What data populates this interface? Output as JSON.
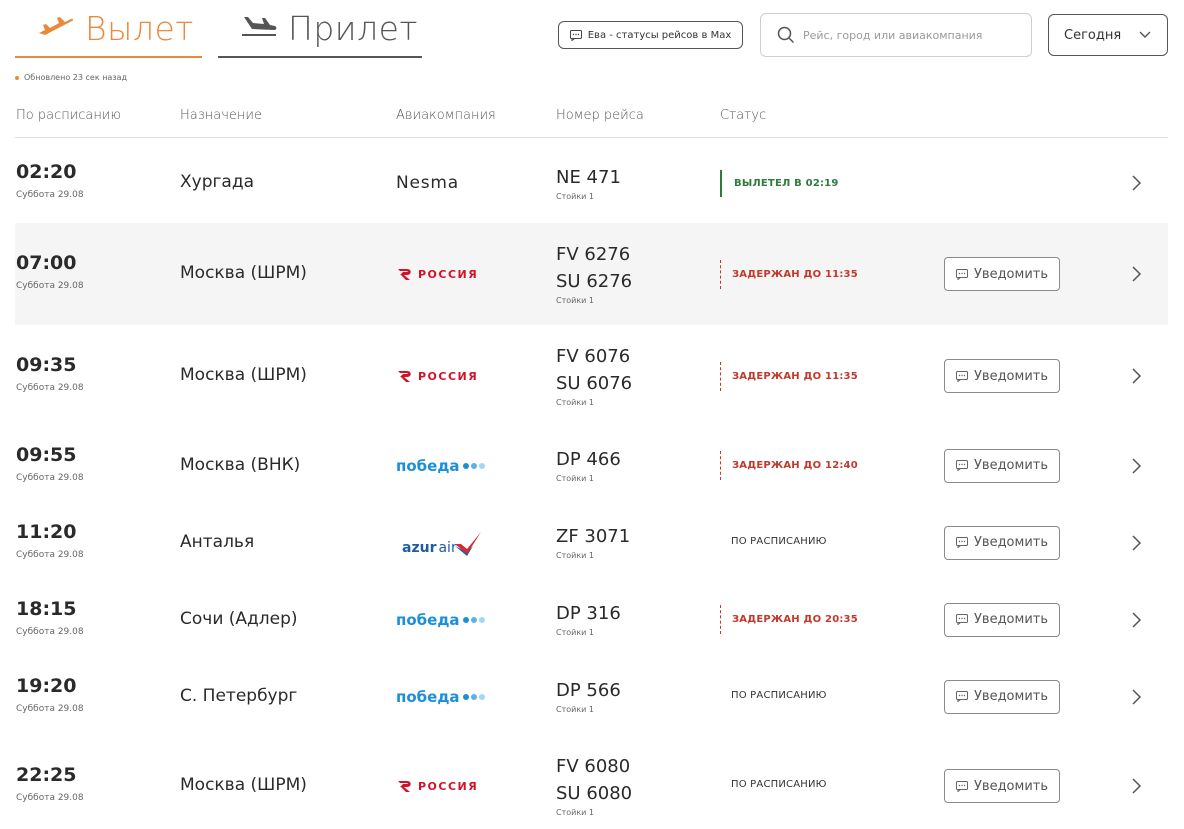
{
  "header": {
    "tab_departure": "Вылет",
    "tab_arrival": "Прилет",
    "updated": "Обновлено 23 сек назад",
    "eva_button": "Ева - статусы рейсов в Max",
    "search_placeholder": "Рейс, город или авиакомпания",
    "date_select": "Сегодня"
  },
  "columns": {
    "scheduled": "По расписанию",
    "destination": "Назначение",
    "airline": "Авиакомпания",
    "flight": "Номер рейса",
    "status": "Статус"
  },
  "notify_label": "Уведомить",
  "airline_labels": {
    "rossiya": "РОССИЯ",
    "pobeda": "победа",
    "azur_1": "azur",
    "azur_2": "air"
  },
  "colors": {
    "accent": "#e88a3c",
    "departed": "#2f7a3d",
    "delayed": "#c0392b",
    "rossiya_red": "#d1132a",
    "pobeda_blue": "#1c8fd9",
    "azur_blue": "#1f5ca8"
  },
  "flights": [
    {
      "time": "02:20",
      "date": "Суббота 29.08",
      "destination": "Хургада",
      "airline": "Nesma",
      "flights": [
        "NE 471"
      ],
      "gates": "Стойки 1",
      "status": "ВЫЛЕТЕЛ В 02:19",
      "status_type": "departed",
      "notify": false
    },
    {
      "time": "07:00",
      "date": "Суббота 29.08",
      "destination": "Москва (ШРМ)",
      "airline": "rossiya",
      "flights": [
        "FV 6276",
        "SU 6276"
      ],
      "gates": "Стойки 1",
      "status": "ЗАДЕРЖАН ДО 11:35",
      "status_type": "delayed",
      "notify": true
    },
    {
      "time": "09:35",
      "date": "Суббота 29.08",
      "destination": "Москва (ШРМ)",
      "airline": "rossiya",
      "flights": [
        "FV 6076",
        "SU 6076"
      ],
      "gates": "Стойки 1",
      "status": "ЗАДЕРЖАН ДО 11:35",
      "status_type": "delayed",
      "notify": true
    },
    {
      "time": "09:55",
      "date": "Суббота 29.08",
      "destination": "Москва (ВНК)",
      "airline": "pobeda",
      "flights": [
        "DP 466"
      ],
      "gates": "Стойки 1",
      "status": "ЗАДЕРЖАН ДО 12:40",
      "status_type": "delayed",
      "notify": true
    },
    {
      "time": "11:20",
      "date": "Суббота 29.08",
      "destination": "Анталья",
      "airline": "azur",
      "flights": [
        "ZF 3071"
      ],
      "gates": "Стойки 1",
      "status": "ПО РАСПИСАНИЮ",
      "status_type": "scheduled",
      "notify": true
    },
    {
      "time": "18:15",
      "date": "Суббота 29.08",
      "destination": "Сочи (Адлер)",
      "airline": "pobeda",
      "flights": [
        "DP 316"
      ],
      "gates": "Стойки 1",
      "status": "ЗАДЕРЖАН ДО 20:35",
      "status_type": "delayed",
      "notify": true
    },
    {
      "time": "19:20",
      "date": "Суббота 29.08",
      "destination": "С. Петербург",
      "airline": "pobeda",
      "flights": [
        "DP 566"
      ],
      "gates": "Стойки 1",
      "status": "ПО РАСПИСАНИЮ",
      "status_type": "scheduled",
      "notify": true
    },
    {
      "time": "22:25",
      "date": "Суббота 29.08",
      "destination": "Москва (ШРМ)",
      "airline": "rossiya",
      "flights": [
        "FV 6080",
        "SU 6080"
      ],
      "gates": "Стойки 1",
      "status": "ПО РАСПИСАНИЮ",
      "status_type": "scheduled",
      "notify": true
    }
  ]
}
